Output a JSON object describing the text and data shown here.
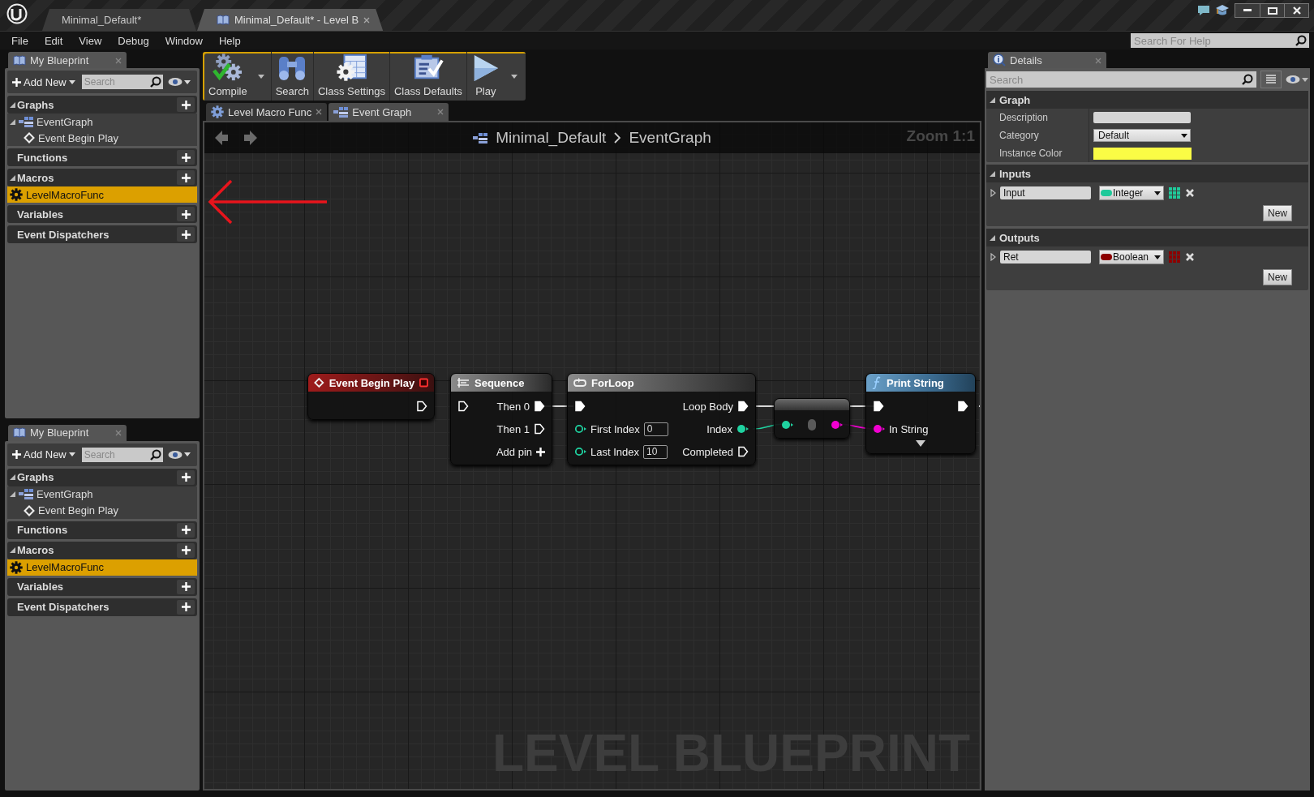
{
  "window": {
    "tabs": [
      {
        "label": "Minimal_Default*",
        "selected": false
      },
      {
        "label": "Minimal_Default* - Level B",
        "selected": true
      }
    ]
  },
  "menu": [
    "File",
    "Edit",
    "View",
    "Debug",
    "Window",
    "Help"
  ],
  "help_search": {
    "placeholder": "Search For Help"
  },
  "blueprint_panels": [
    {
      "title": "My Blueprint",
      "add_button": "Add New",
      "search": {
        "placeholder": "Search"
      },
      "sections": [
        {
          "label": "Graphs",
          "expanded": true,
          "items": [
            {
              "label": "EventGraph",
              "kind": "graph",
              "selected": false,
              "expanded": true,
              "children": [
                {
                  "label": "Event Begin Play",
                  "kind": "event",
                  "selected": false
                }
              ]
            }
          ]
        },
        {
          "label": "Functions",
          "expanded": false
        },
        {
          "label": "Macros",
          "expanded": true,
          "items": [
            {
              "label": "LevelMacroFunc",
              "kind": "macro",
              "selected": true
            }
          ]
        },
        {
          "label": "Variables",
          "expanded": false
        },
        {
          "label": "Event Dispatchers",
          "expanded": false
        }
      ]
    },
    {
      "title": "My Blueprint",
      "add_button": "Add New",
      "search": {
        "placeholder": "Search"
      },
      "sections": [
        {
          "label": "Graphs",
          "expanded": true,
          "items": [
            {
              "label": "EventGraph",
              "kind": "graph",
              "selected": false,
              "expanded": true,
              "children": [
                {
                  "label": "Event Begin Play",
                  "kind": "event",
                  "selected": false
                }
              ]
            }
          ]
        },
        {
          "label": "Functions",
          "expanded": false
        },
        {
          "label": "Macros",
          "expanded": true,
          "items": [
            {
              "label": "LevelMacroFunc",
              "kind": "macro",
              "selected": true
            }
          ]
        },
        {
          "label": "Variables",
          "expanded": false
        },
        {
          "label": "Event Dispatchers",
          "expanded": false
        }
      ]
    }
  ],
  "toolbar": [
    {
      "label": "Compile",
      "kind": "compile",
      "dropdown": true
    },
    {
      "label": "Search",
      "kind": "search",
      "dropdown": false
    },
    {
      "label": "Class Settings",
      "kind": "settings",
      "dropdown": false
    },
    {
      "label": "Class Defaults",
      "kind": "defaults",
      "dropdown": false
    },
    {
      "label": "Play",
      "kind": "play",
      "dropdown": true
    }
  ],
  "document_tabs": [
    {
      "label": "Level Macro Func",
      "kind": "macro",
      "selected": false
    },
    {
      "label": "Event Graph",
      "kind": "graph",
      "selected": true
    }
  ],
  "graph": {
    "breadcrumb": [
      "Minimal_Default",
      "EventGraph"
    ],
    "zoom": "Zoom 1:1",
    "watermark": "LEVEL BLUEPRINT",
    "nodes": [
      {
        "kind": "event",
        "title": "Event Begin Play",
        "rows": [
          {
            "right": {
              "kind": "exec",
              "connected": false
            }
          }
        ]
      },
      {
        "kind": "sequence",
        "title": "Sequence",
        "rows": [
          {
            "left": {
              "kind": "exec",
              "connected": false
            },
            "right": {
              "label": "Then 0",
              "kind": "exec",
              "connected": true
            }
          },
          {
            "right": {
              "label": "Then 1",
              "kind": "exec",
              "connected": false
            }
          },
          {
            "right": {
              "label": "Add pin",
              "kind": "add"
            }
          }
        ]
      },
      {
        "kind": "macro",
        "title": "ForLoop",
        "rows": [
          {
            "left": {
              "kind": "exec",
              "connected": true
            },
            "right": {
              "label": "Loop Body",
              "kind": "exec",
              "connected": true
            }
          },
          {
            "left": {
              "label": "First Index",
              "kind": "int",
              "connected": false,
              "value": "0"
            },
            "right": {
              "label": "Index",
              "kind": "int",
              "connected": true
            }
          },
          {
            "left": {
              "label": "Last Index",
              "kind": "int",
              "connected": false,
              "value": "10"
            },
            "right": {
              "label": "Completed",
              "kind": "exec",
              "connected": false
            }
          }
        ]
      },
      {
        "kind": "conversion",
        "rows": [
          {
            "left": {
              "kind": "int",
              "connected": true
            },
            "right": {
              "kind": "string",
              "connected": true
            }
          }
        ]
      },
      {
        "kind": "function",
        "title": "Print String",
        "advanced": true,
        "rows": [
          {
            "left": {
              "kind": "exec",
              "connected": true
            },
            "right": {
              "kind": "exec",
              "connected": true
            }
          },
          {
            "left": {
              "label": "In String",
              "kind": "string",
              "connected": true
            }
          }
        ]
      }
    ]
  },
  "details": {
    "tab": "Details",
    "search": {
      "placeholder": "Search"
    },
    "sections": [
      {
        "label": "Graph",
        "kind": "properties",
        "expanded": true,
        "rows": [
          {
            "label": "Description",
            "kind": "text"
          },
          {
            "label": "Category",
            "kind": "dropdown",
            "value": "Default"
          },
          {
            "label": "Instance Color",
            "kind": "color",
            "color": "#fafc45"
          }
        ]
      },
      {
        "label": "Inputs",
        "kind": "params",
        "expanded": true,
        "params": [
          {
            "name": "Input",
            "type": "Integer",
            "color": "#1fc99a"
          }
        ],
        "button": "New"
      },
      {
        "label": "Outputs",
        "kind": "params",
        "expanded": true,
        "params": [
          {
            "name": "Ret",
            "type": "Boolean",
            "color": "#8c0000"
          }
        ],
        "button": "New"
      }
    ]
  }
}
